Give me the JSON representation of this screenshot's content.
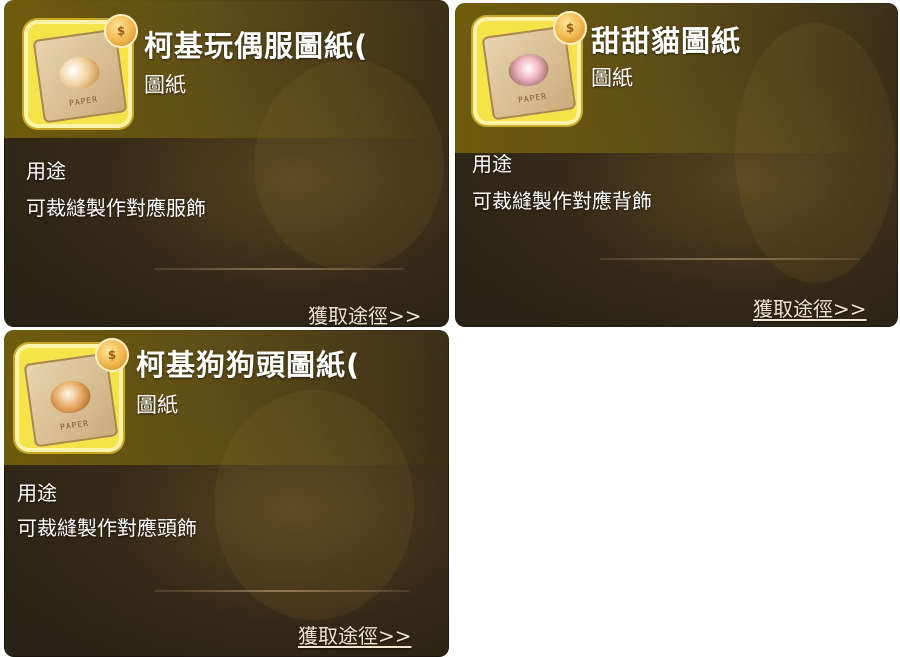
{
  "cards": [
    {
      "title": "柯基玩偶服圖紙(",
      "type": "圖紙",
      "usage_label": "用途",
      "usage_text": "可裁縫製作對應服飾",
      "get_path": "獲取途徑>>",
      "paper_text": "PAPER"
    },
    {
      "title": "甜甜貓圖紙",
      "type": "圖紙",
      "usage_label": "用途",
      "usage_text": "可裁縫製作對應背飾",
      "get_path": "獲取途徑>>",
      "paper_text": "PAPER"
    },
    {
      "title": "柯基狗狗頭圖紙(",
      "type": "圖紙",
      "usage_label": "用途",
      "usage_text": "可裁縫製作對應頭飾",
      "get_path": "獲取途徑>>",
      "paper_text": "PAPER"
    }
  ],
  "icons": {
    "blueprint": "blueprint-paper-icon",
    "bag": "shop-bag-icon"
  },
  "colors": {
    "title_text": "#ffffff",
    "icon_frame": "#f5e34a",
    "bag_badge": "#f2b64a",
    "link_text": "#f1e6d0"
  }
}
